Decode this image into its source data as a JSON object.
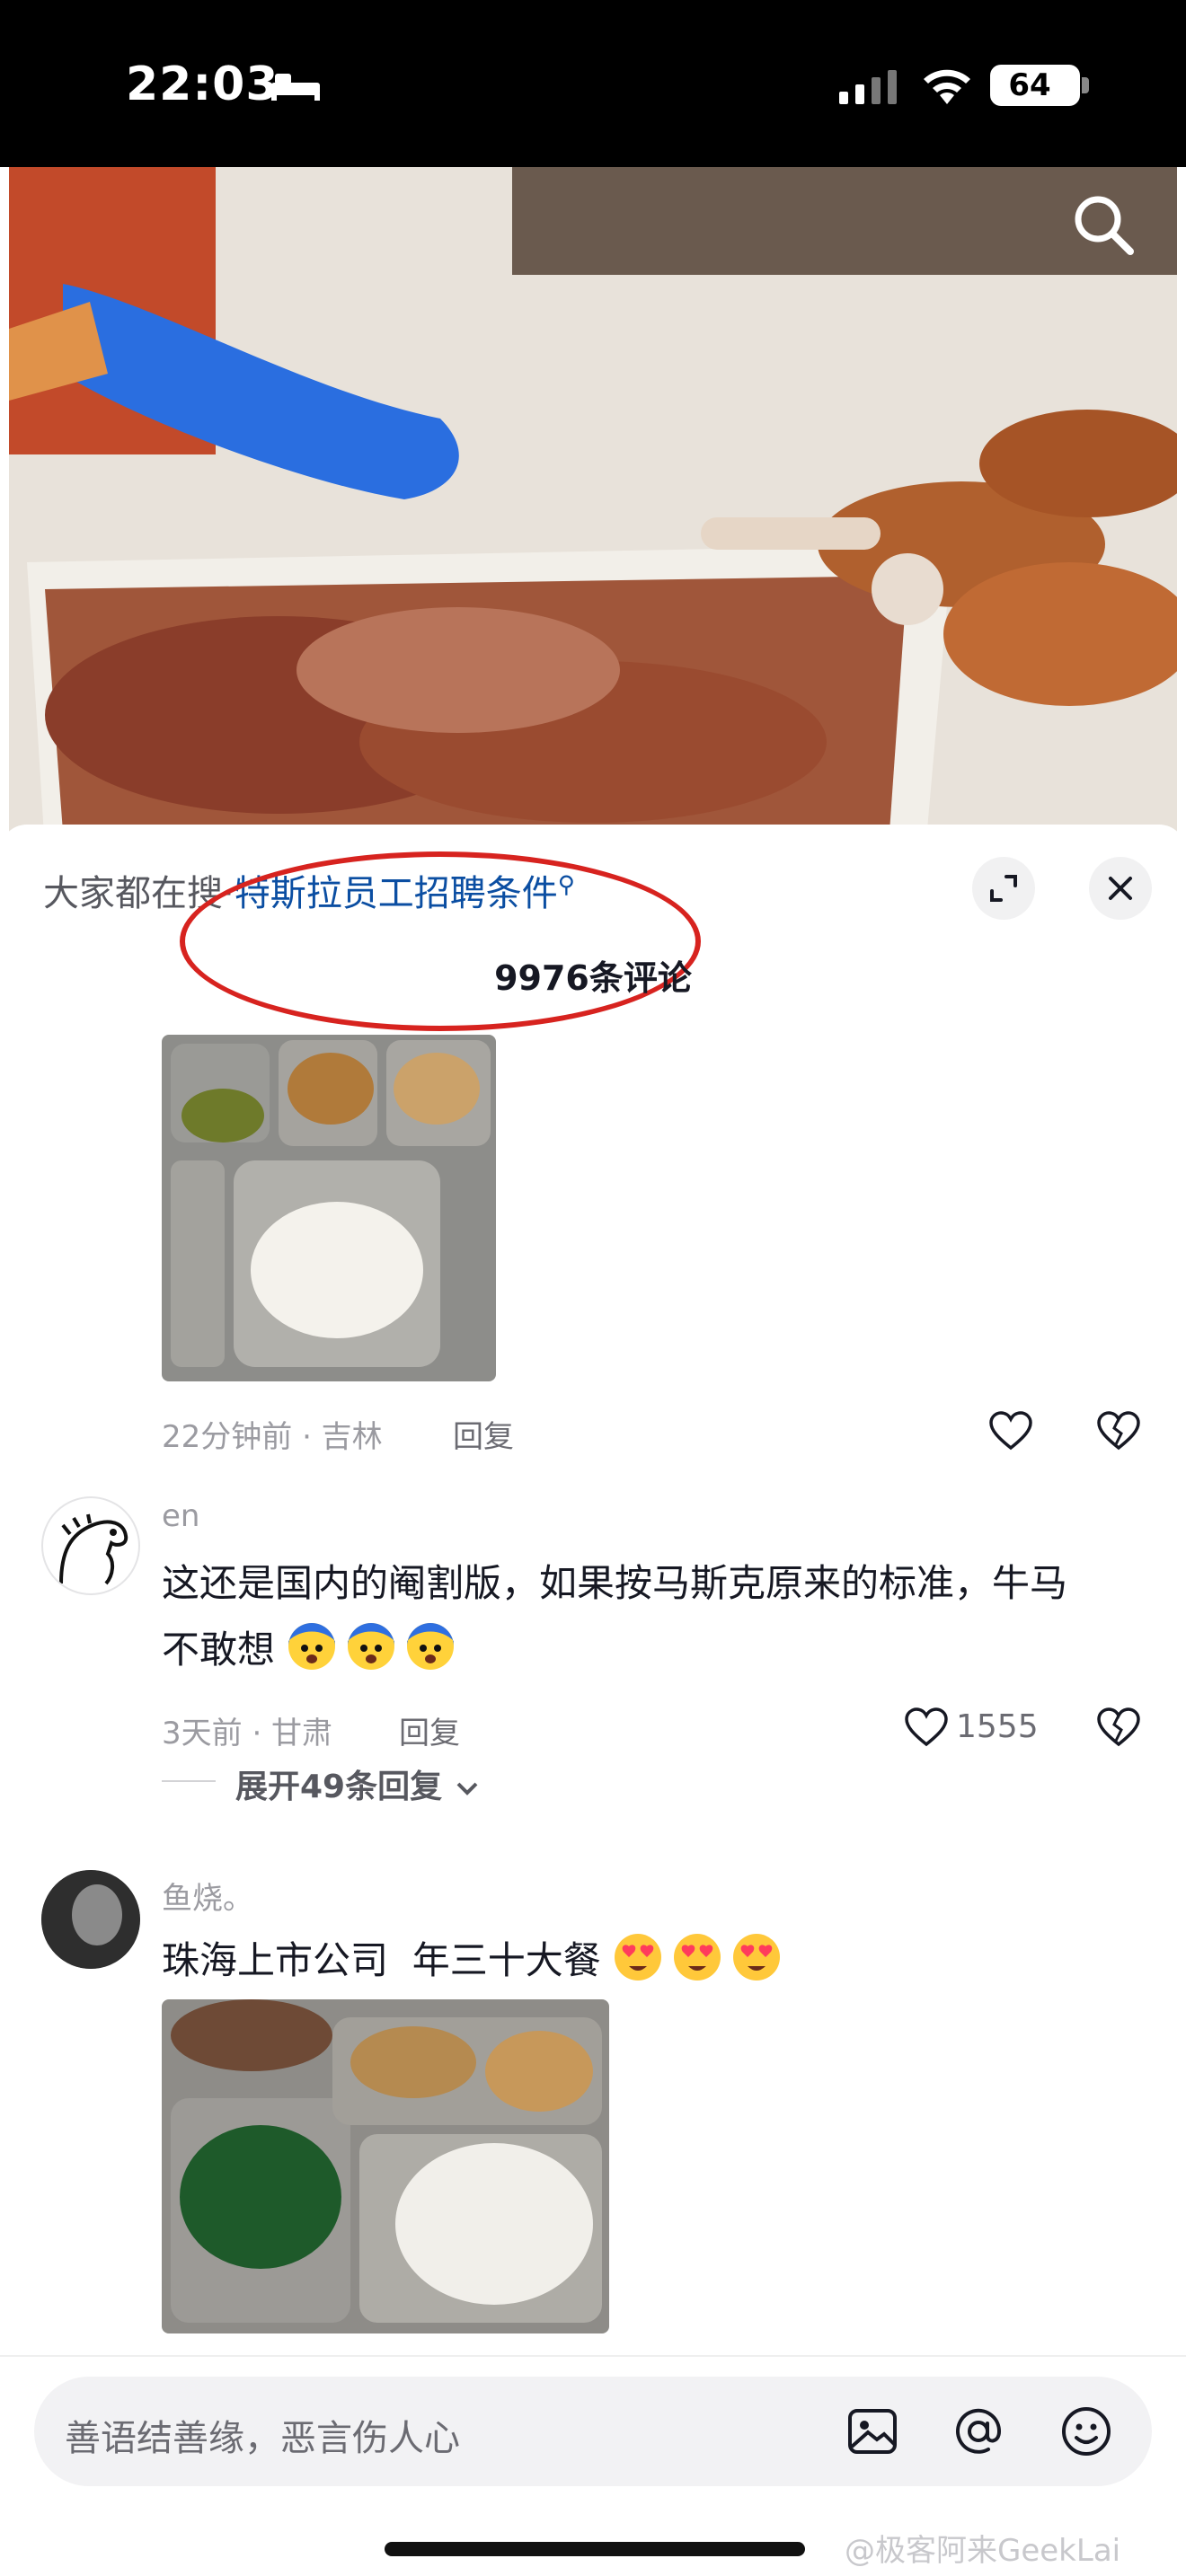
{
  "status_bar": {
    "time": "22:03",
    "battery": "64"
  },
  "panel": {
    "search_prefix": "大家都在搜·",
    "search_link": "特斯拉员工招聘条件",
    "comment_count": "9976条评论"
  },
  "comments": [
    {
      "meta": "22分钟前 · 吉林",
      "reply": "回复"
    },
    {
      "username": "en",
      "text_line1": "这还是国内的阉割版，如果按马斯克原来的标准，牛马",
      "text_line2": "不敢想",
      "meta": "3天前 · 甘肃",
      "reply": "回复",
      "likes": "1555",
      "expand": "展开49条回复"
    },
    {
      "username": "鱼烧。",
      "text": "珠海上市公司  年三十大餐"
    }
  ],
  "input": {
    "placeholder": "善语结善缘，恶言伤人心"
  },
  "watermark": "@极客阿来GeekLai",
  "colors": {
    "annotation": "#d7231f",
    "link": "#0b4ea2"
  }
}
